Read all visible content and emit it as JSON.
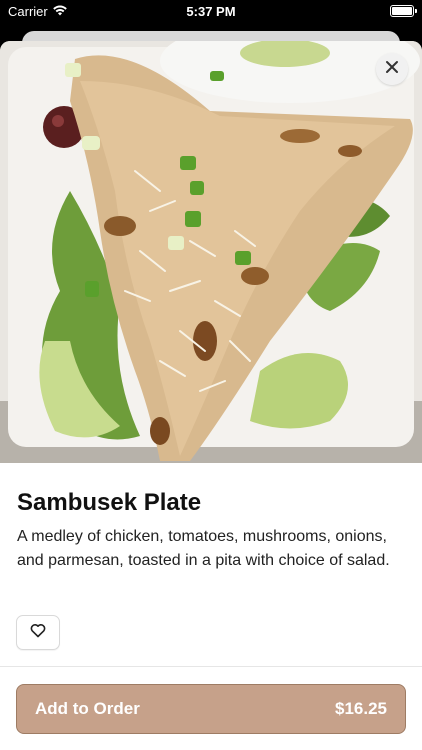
{
  "status_bar": {
    "carrier": "Carrier",
    "time": "5:37 PM",
    "wifi_icon": "wifi-icon",
    "battery_level": 1.0
  },
  "header": {
    "close_icon": "close-icon"
  },
  "item": {
    "name": "Sambusek Plate",
    "description": "A medley of chicken, tomatoes, mushrooms, onions, and parmesan, toasted in a pita with choice of salad.",
    "favorite_icon": "heart-outline-icon"
  },
  "order": {
    "add_label": "Add to Order",
    "price": "$16.25"
  },
  "colors": {
    "accent": "#c6a18a",
    "accent_border": "#9e7c64",
    "background": "#ffffff"
  }
}
